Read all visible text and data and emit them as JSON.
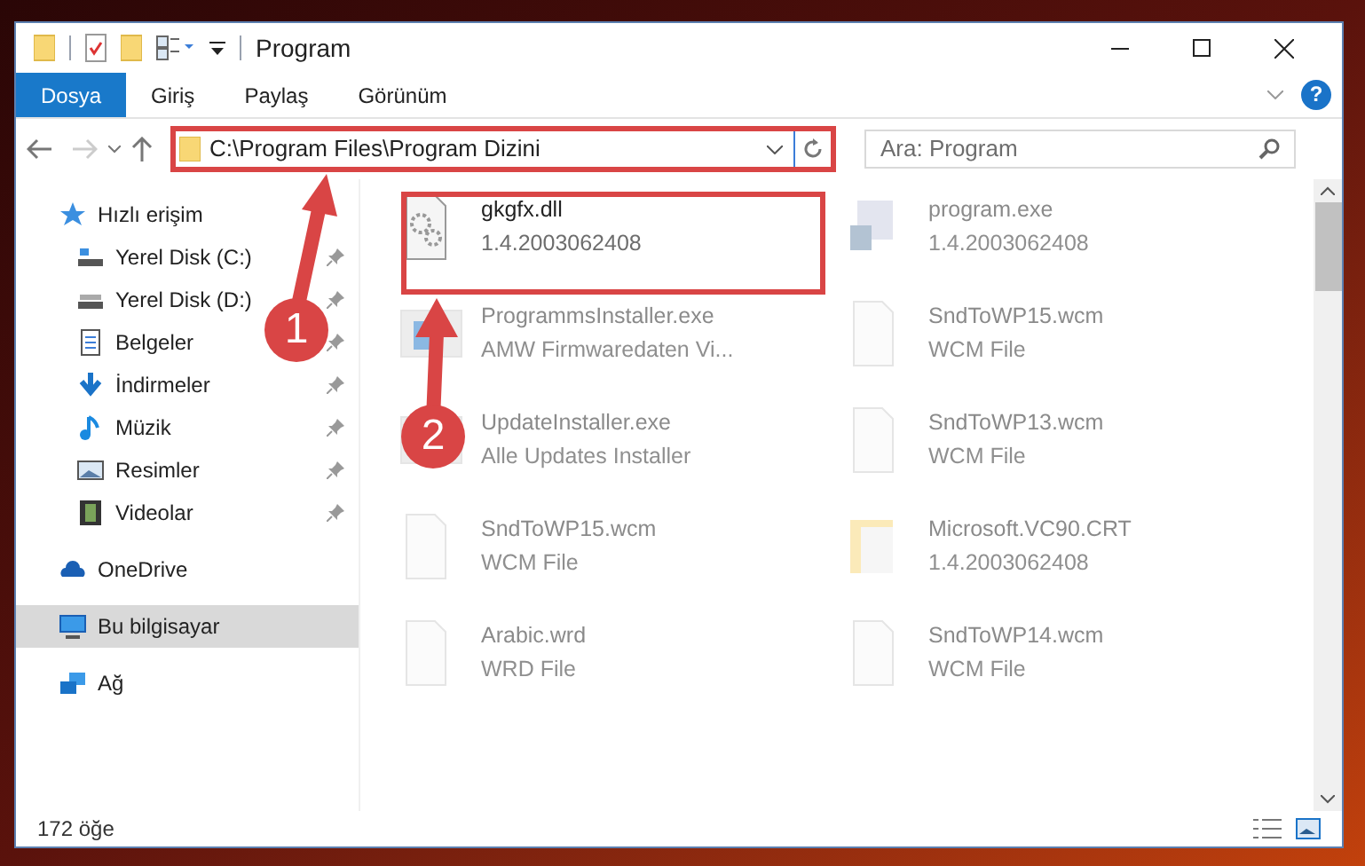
{
  "window": {
    "title": "Program"
  },
  "ribbon_tabs": [
    {
      "label": "Dosya",
      "selected": true
    },
    {
      "label": "Giriş",
      "selected": false
    },
    {
      "label": "Paylaş",
      "selected": false
    },
    {
      "label": "Görünüm",
      "selected": false
    }
  ],
  "help_button": {
    "label": "?"
  },
  "address_bar": {
    "path": "C:\\Program Files\\Program Dizini"
  },
  "search": {
    "placeholder": "Ara: Program"
  },
  "sidebar": {
    "items": [
      {
        "label": "Hızlı erişim",
        "kind": "section",
        "selected": false,
        "pinned": false
      },
      {
        "label": "Yerel Disk (C:)",
        "kind": "child",
        "selected": false,
        "pinned": true
      },
      {
        "label": "Yerel Disk (D:)",
        "kind": "child",
        "selected": false,
        "pinned": true
      },
      {
        "label": "Belgeler",
        "kind": "child",
        "selected": false,
        "pinned": true
      },
      {
        "label": "İndirmeler",
        "kind": "child",
        "selected": false,
        "pinned": true
      },
      {
        "label": "Müzik",
        "kind": "child",
        "selected": false,
        "pinned": true
      },
      {
        "label": "Resimler",
        "kind": "child",
        "selected": false,
        "pinned": true
      },
      {
        "label": "Videolar",
        "kind": "child",
        "selected": false,
        "pinned": true
      },
      {
        "label": "OneDrive",
        "kind": "section",
        "selected": false,
        "pinned": false
      },
      {
        "label": "Bu bilgisayar",
        "kind": "section",
        "selected": true,
        "pinned": false
      },
      {
        "label": "Ağ",
        "kind": "section",
        "selected": false,
        "pinned": false
      }
    ]
  },
  "files": [
    {
      "name": "gkgfx.dll",
      "detail": "1.4.2003062408",
      "faded": false
    },
    {
      "name": "program.exe",
      "detail": "1.4.2003062408",
      "faded": true
    },
    {
      "name": "ProgrammsInstaller.exe",
      "detail": "AMW Firmwaredaten Vi...",
      "faded": true
    },
    {
      "name": "SndToWP15.wcm",
      "detail": "WCM File",
      "faded": true
    },
    {
      "name": "UpdateInstaller.exe",
      "detail": "Alle Updates Installer",
      "faded": true
    },
    {
      "name": "SndToWP13.wcm",
      "detail": "WCM File",
      "faded": true
    },
    {
      "name": "SndToWP15.wcm",
      "detail": "WCM File",
      "faded": true
    },
    {
      "name": "Microsoft.VC90.CRT",
      "detail": "1.4.2003062408",
      "faded": true
    },
    {
      "name": "Arabic.wrd",
      "detail": "WRD File",
      "faded": true
    },
    {
      "name": "SndToWP14.wcm",
      "detail": "WCM File",
      "faded": true
    }
  ],
  "status_bar": {
    "item_count": "172 öğe"
  },
  "annotations": [
    {
      "number": "1"
    },
    {
      "number": "2"
    }
  ]
}
